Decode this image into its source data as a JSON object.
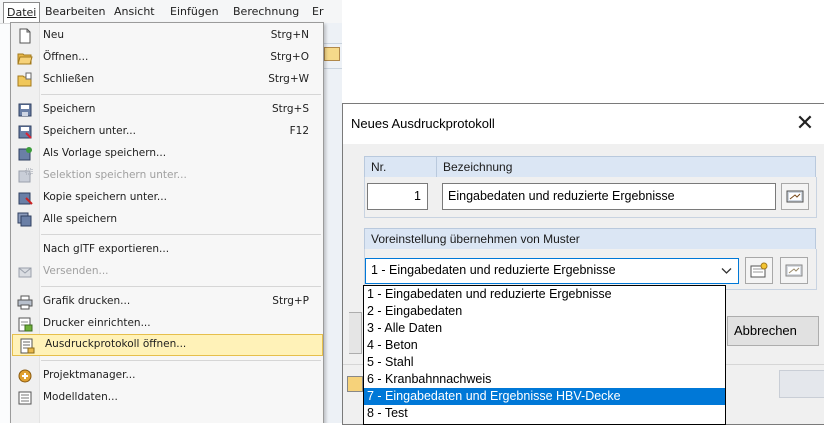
{
  "menubar": {
    "items": [
      {
        "label": "Datei"
      },
      {
        "label": "Bearbeiten"
      },
      {
        "label": "Ansicht"
      },
      {
        "label": "Einfügen"
      },
      {
        "label": "Berechnung"
      },
      {
        "label": "Er"
      }
    ]
  },
  "file_menu": {
    "items": [
      {
        "label": "Neu",
        "shortcut": "Strg+N",
        "icon": "new-file-icon"
      },
      {
        "label": "Öffnen...",
        "shortcut": "Strg+O",
        "icon": "open-folder-icon"
      },
      {
        "label": "Schließen",
        "shortcut": "Strg+W",
        "icon": "close-folder-icon"
      },
      {
        "label": "Speichern",
        "shortcut": "Strg+S",
        "icon": "save-icon"
      },
      {
        "label": "Speichern unter...",
        "shortcut": "F12",
        "icon": "save-as-icon"
      },
      {
        "label": "Als Vorlage speichern...",
        "shortcut": "",
        "icon": "save-template-icon"
      },
      {
        "label": "Selektion speichern unter...",
        "shortcut": "",
        "icon": "save-selection-icon",
        "disabled": true
      },
      {
        "label": "Kopie speichern unter...",
        "shortcut": "",
        "icon": "save-copy-icon"
      },
      {
        "label": "Alle speichern",
        "shortcut": "",
        "icon": "save-all-icon"
      },
      {
        "label": "Nach glTF exportieren...",
        "shortcut": "",
        "icon": ""
      },
      {
        "label": "Versenden...",
        "shortcut": "",
        "icon": "send-icon",
        "disabled": true
      },
      {
        "label": "Grafik drucken...",
        "shortcut": "Strg+P",
        "icon": "print-graphic-icon"
      },
      {
        "label": "Drucker einrichten...",
        "shortcut": "",
        "icon": "printer-setup-icon"
      },
      {
        "label": "Ausdruckprotokoll öffnen...",
        "shortcut": "",
        "icon": "printout-report-icon",
        "highlighted": true
      },
      {
        "label": "Projektmanager...",
        "shortcut": "",
        "icon": "project-manager-icon"
      },
      {
        "label": "Modelldaten...",
        "shortcut": "",
        "icon": "model-data-icon"
      }
    ]
  },
  "dialog": {
    "title": "Neues Ausdruckprotokoll",
    "close_label": "✕",
    "nr_label": "Nr.",
    "nr_value": "1",
    "bezeichnung_label": "Bezeichnung",
    "bezeichnung_value": "Eingabedaten und reduzierte Ergebnisse",
    "template_label": "Voreinstellung übernehmen von Muster",
    "template_selected": "1 - Eingabedaten und reduzierte Ergebnisse",
    "cancel_label": "Abbrechen",
    "template_options": [
      "1 - Eingabedaten und reduzierte Ergebnisse",
      "2 - Eingabedaten",
      "3 - Alle Daten",
      "4 - Beton",
      "5 - Stahl",
      "6 - Kranbahnnachweis",
      "7 - Eingabedaten und Ergebnisse HBV-Decke",
      "8 - Test"
    ],
    "highlighted_option_index": 6
  },
  "colors": {
    "accent": "#0078d7",
    "menu_highlight": "#fff2b8",
    "group_header": "#dbe6f4"
  }
}
